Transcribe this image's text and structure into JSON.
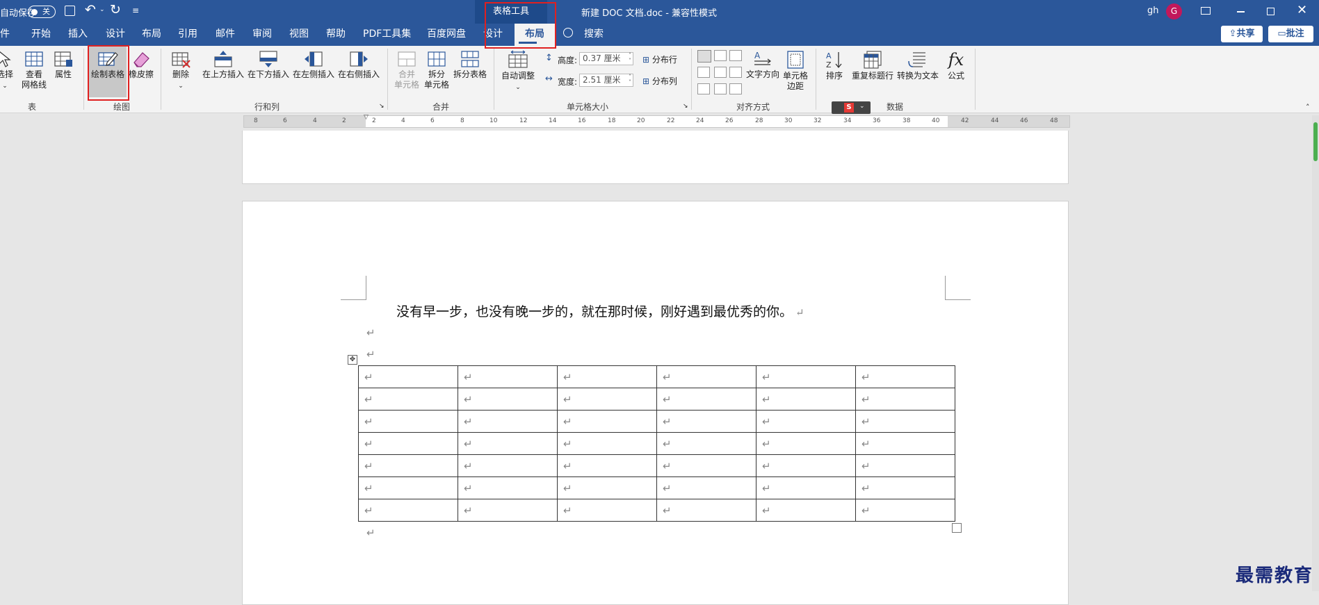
{
  "titlebar": {
    "autosave_label": "自动保存",
    "autosave_state": "关",
    "context_tab": "表格工具",
    "doc_title": "新建 DOC 文档.doc  -  兼容性模式",
    "user_name": "gh",
    "avatar_letter": "G"
  },
  "tabs": [
    "文件",
    "开始",
    "插入",
    "设计",
    "布局",
    "引用",
    "邮件",
    "审阅",
    "视图",
    "帮助",
    "PDF工具集",
    "百度网盘",
    "设计",
    "布局"
  ],
  "search_label": "搜索",
  "share_label": "共享",
  "comment_label": "批注",
  "ribbon": {
    "select": "选择",
    "view_grid_1": "查看",
    "view_grid_2": "网格线",
    "properties": "属性",
    "draw_table": "绘制表格",
    "eraser": "橡皮擦",
    "delete": "删除",
    "insert_above": "在上方插入",
    "insert_below": "在下方插入",
    "insert_left": "在左侧插入",
    "insert_right": "在右侧插入",
    "merge_1": "合并",
    "merge_2": "单元格",
    "split_1": "拆分",
    "split_2": "单元格",
    "split_table": "拆分表格",
    "autofit": "自动调整",
    "height_label": "高度:",
    "height_value": "0.37 厘米",
    "width_label": "宽度:",
    "width_value": "2.51 厘米",
    "dist_rows": "分布行",
    "dist_cols": "分布列",
    "text_direction": "文字方向",
    "cell_margins_1": "单元格",
    "cell_margins_2": "边距",
    "sort": "排序",
    "repeat_header": "重复标题行",
    "convert_text": "转换为文本",
    "formula": "公式",
    "groups": {
      "table": "表",
      "draw": "绘图",
      "rows_cols": "行和列",
      "merge": "合并",
      "cell_size": "单元格大小",
      "align": "对齐方式",
      "data": "数据"
    }
  },
  "ruler_labels": [
    "8",
    "6",
    "4",
    "2",
    "2",
    "4",
    "6",
    "8",
    "10",
    "12",
    "14",
    "16",
    "18",
    "20",
    "22",
    "24",
    "26",
    "28",
    "30",
    "32",
    "34",
    "36",
    "38",
    "40",
    "42",
    "44",
    "46",
    "48"
  ],
  "document": {
    "sentence": "没有早一步，也没有晚一步的，就在那时候，刚好遇到最优秀的你。",
    "para_mark": "↵",
    "table_rows": 7,
    "table_cols": 6
  },
  "watermark": "最需教育"
}
